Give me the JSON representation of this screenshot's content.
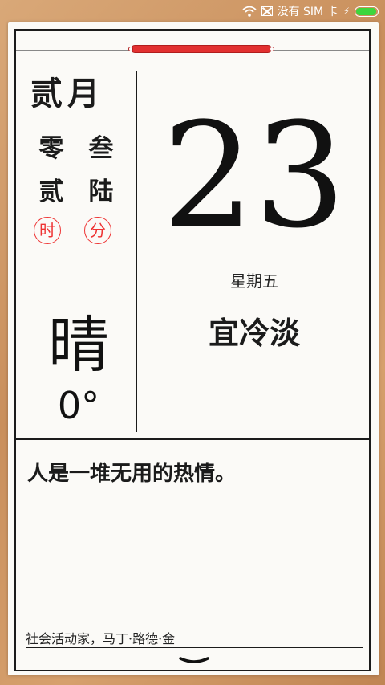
{
  "status_bar": {
    "sim_text": "没有 SIM 卡",
    "battery_fill_fraction": 0.95,
    "battery_color": "#3dd63d"
  },
  "calendar": {
    "month": "贰月",
    "hour_digits": [
      "零",
      "贰"
    ],
    "minute_digits": [
      "叁",
      "陆"
    ],
    "hour_stamp": "时",
    "minute_stamp": "分",
    "day": "23",
    "weekday": "星期五",
    "yi_text": "宜冷淡",
    "accent_color": "#e23030"
  },
  "weather": {
    "condition": "晴",
    "temperature": "0°"
  },
  "quote": {
    "text": "人是一堆无用的热情。",
    "author": "社会活动家，马丁·路德·金"
  },
  "icons": {
    "wifi": "wifi-icon",
    "sim": "no-sim-icon",
    "charging": "charging-icon",
    "battery": "battery-icon",
    "expand": "chevron-down-icon"
  }
}
